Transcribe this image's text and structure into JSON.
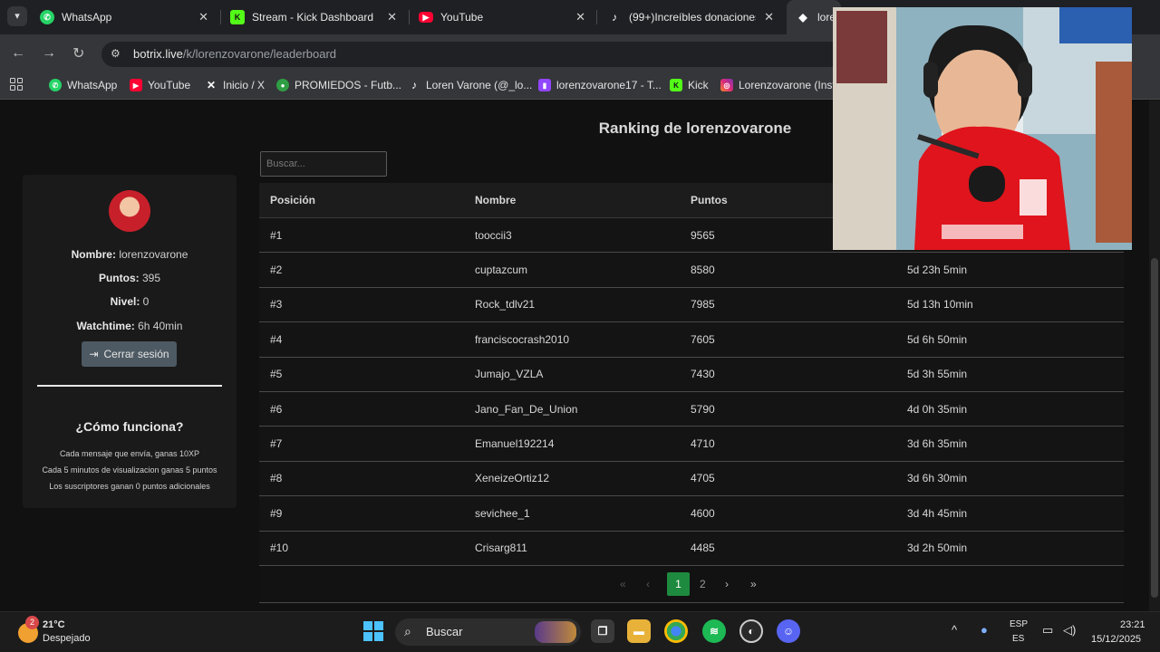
{
  "browser": {
    "tabs": [
      {
        "label": "WhatsApp",
        "close": "✕"
      },
      {
        "label": "Stream - Kick Dashboard",
        "close": "✕"
      },
      {
        "label": "YouTube",
        "close": "✕"
      },
      {
        "label": "(99+)Increíbles donaciones",
        "close": "✕"
      },
      {
        "label": "lore"
      }
    ],
    "url_host": "botrix.live",
    "url_path": "/k/lorenzovarone/leaderboard",
    "bookmarks": [
      {
        "label": "WhatsApp",
        "icon": "whatsapp-icon"
      },
      {
        "label": "YouTube",
        "icon": "youtube-icon"
      },
      {
        "label": "Inicio / X",
        "icon": "x-icon"
      },
      {
        "label": "PROMIEDOS - Futb...",
        "icon": "promiedos-icon"
      },
      {
        "label": "Loren Varone (@_lo...",
        "icon": "tiktok-icon"
      },
      {
        "label": "lorenzovarone17 - T...",
        "icon": "twitch-icon"
      },
      {
        "label": "Kick",
        "icon": "kick-icon"
      },
      {
        "label": "Lorenzovarone (Inst...",
        "icon": "instagram-icon"
      }
    ]
  },
  "page": {
    "title": "Ranking de lorenzovarone",
    "search_placeholder": "Buscar..."
  },
  "profile": {
    "name_label": "Nombre:",
    "name_value": "lorenzovarone",
    "points_label": "Puntos:",
    "points_value": "395",
    "level_label": "Nivel:",
    "level_value": "0",
    "watchtime_label": "Watchtime:",
    "watchtime_value": "6h 40min",
    "logout_label": "Cerrar sesión",
    "how_title": "¿Cómo funciona?",
    "how_lines": [
      "Cada mensaje que envía, ganas 10XP",
      "Cada 5 minutos de visualizacion ganas 5 puntos",
      "Los suscriptores ganan 0 puntos adicionales"
    ]
  },
  "table": {
    "headers": [
      "Posición",
      "Nombre",
      "Puntos",
      ""
    ],
    "rows": [
      {
        "pos": "#1",
        "name": "tooccii3",
        "points": "9565",
        "time": ""
      },
      {
        "pos": "#2",
        "name": "cuptazcum",
        "points": "8580",
        "time": "5d 23h 5min"
      },
      {
        "pos": "#3",
        "name": "Rock_tdlv21",
        "points": "7985",
        "time": "5d 13h 10min"
      },
      {
        "pos": "#4",
        "name": "franciscocrash2010",
        "points": "7605",
        "time": "5d 6h 50min"
      },
      {
        "pos": "#5",
        "name": "Jumajo_VZLA",
        "points": "7430",
        "time": "5d 3h 55min"
      },
      {
        "pos": "#6",
        "name": "Jano_Fan_De_Union",
        "points": "5790",
        "time": "4d 0h 35min"
      },
      {
        "pos": "#7",
        "name": "Emanuel192214",
        "points": "4710",
        "time": "3d 6h 35min"
      },
      {
        "pos": "#8",
        "name": "XeneizeOrtiz12",
        "points": "4705",
        "time": "3d 6h 30min"
      },
      {
        "pos": "#9",
        "name": "sevichee_1",
        "points": "4600",
        "time": "3d 4h 45min"
      },
      {
        "pos": "#10",
        "name": "Crisarg811",
        "points": "4485",
        "time": "3d 2h 50min"
      }
    ]
  },
  "pagination": {
    "first": "«",
    "prev": "‹",
    "current": "1",
    "next_page": "2",
    "next": "›",
    "last": "»"
  },
  "taskbar": {
    "weather_badge": "2",
    "temperature": "21°C",
    "condition": "Despejado",
    "search_label": "Buscar",
    "lang_top": "ESP",
    "lang_bottom": "ES",
    "time": "23:21",
    "date": "15/12/2025"
  }
}
